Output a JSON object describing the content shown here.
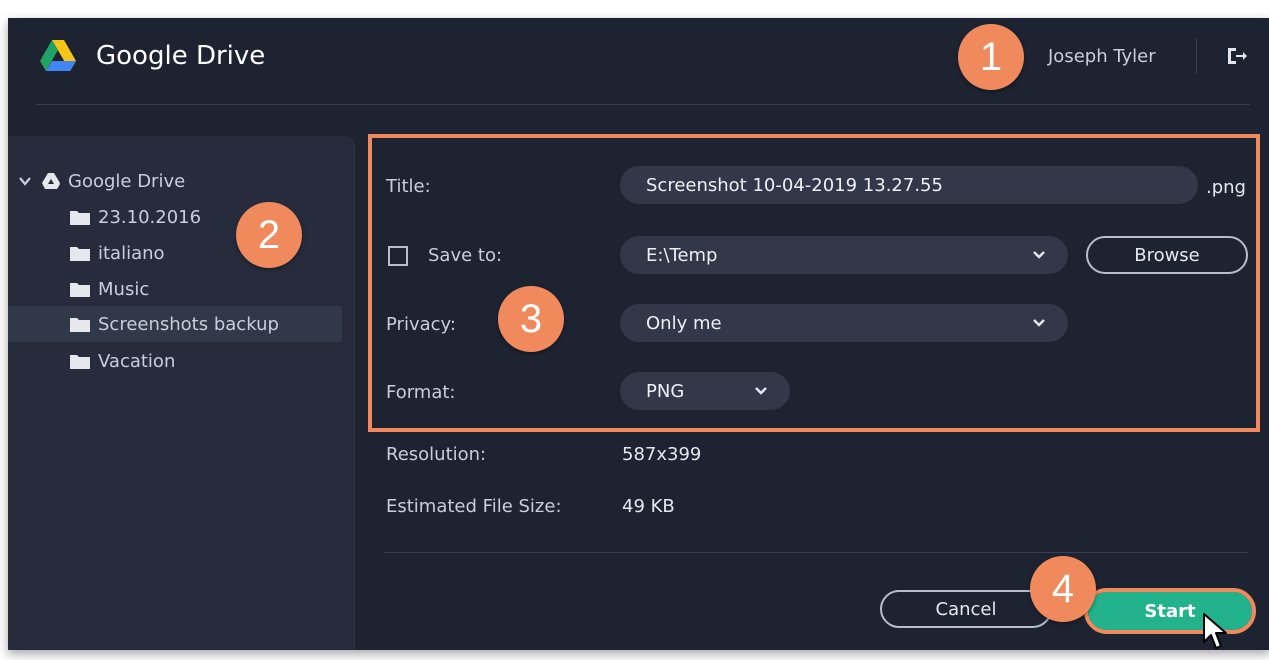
{
  "app": {
    "title": "Google Drive"
  },
  "header": {
    "user_name": "Joseph Tyler"
  },
  "sidebar": {
    "root_label": "Google Drive",
    "folders": [
      {
        "label": "23.10.2016"
      },
      {
        "label": "italiano"
      },
      {
        "label": "Music"
      },
      {
        "label": "Screenshots backup",
        "selected": true
      },
      {
        "label": "Vacation"
      }
    ]
  },
  "form": {
    "title_label": "Title:",
    "title_value": "Screenshot 10-04-2019 13.27.55",
    "title_ext": ".png",
    "save_to_label": "Save to:",
    "save_to_checked": false,
    "save_to_value": "E:\\Temp",
    "browse_label": "Browse",
    "privacy_label": "Privacy:",
    "privacy_value": "Only me",
    "format_label": "Format:",
    "format_value": "PNG",
    "resolution_label": "Resolution:",
    "resolution_value": "587x399",
    "filesize_label": "Estimated File Size:",
    "filesize_value": "49 KB"
  },
  "footer": {
    "cancel_label": "Cancel",
    "start_label": "Start"
  },
  "callouts": [
    "1",
    "2",
    "3",
    "4"
  ],
  "colors": {
    "window_bg": "#1e2332",
    "sidebar_bg": "#262c3c",
    "field_bg": "#323849",
    "accent_green": "#23b38c",
    "callout_orange": "#f08a5d"
  }
}
